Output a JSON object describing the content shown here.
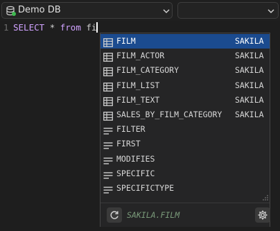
{
  "toolbar": {
    "database_label": "Demo DB",
    "schema_label": ""
  },
  "editor": {
    "line_number": "1",
    "keyword_select": "SELECT",
    "star": "*",
    "keyword_from": "from",
    "typed": "fi"
  },
  "autocomplete": {
    "items": [
      {
        "name": "FILM",
        "schema": "SAKILA",
        "icon": "table-icon",
        "selected": true
      },
      {
        "name": "FILM_ACTOR",
        "schema": "SAKILA",
        "icon": "table-icon"
      },
      {
        "name": "FILM_CATEGORY",
        "schema": "SAKILA",
        "icon": "table-icon"
      },
      {
        "name": "FILM_LIST",
        "schema": "SAKILA",
        "icon": "table-icon"
      },
      {
        "name": "FILM_TEXT",
        "schema": "SAKILA",
        "icon": "table-icon"
      },
      {
        "name": "SALES_BY_FILM_CATEGORY",
        "schema": "SAKILA",
        "icon": "table-icon"
      },
      {
        "name": "FILTER",
        "schema": "",
        "icon": "keyword-icon"
      },
      {
        "name": "FIRST",
        "schema": "",
        "icon": "keyword-icon"
      },
      {
        "name": "MODIFIES",
        "schema": "",
        "icon": "keyword-icon"
      },
      {
        "name": "SPECIFIC",
        "schema": "",
        "icon": "keyword-icon"
      },
      {
        "name": "SPECIFICTYPE",
        "schema": "",
        "icon": "keyword-icon"
      }
    ],
    "footer_text": "SAKILA.FILM"
  },
  "colors": {
    "selection": "#1b4b8f",
    "keyword": "#d0a2ff",
    "background": "#1e1e1e"
  }
}
